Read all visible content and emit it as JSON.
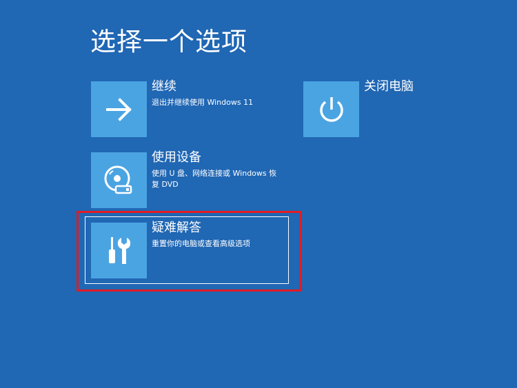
{
  "page_title": "选择一个选项",
  "options": {
    "continue": {
      "title": "继续",
      "description": "退出并继续使用 Windows 11",
      "icon": "arrow-right-icon"
    },
    "shutdown": {
      "title": "关闭电脑",
      "icon": "power-icon"
    },
    "use_device": {
      "title": "使用设备",
      "description": "使用 U 盘、网络连接或 Windows 恢复 DVD",
      "icon": "disc-drive-icon"
    },
    "troubleshoot": {
      "title": "疑难解答",
      "description": "重置你的电脑或查看高级选项",
      "icon": "tools-icon",
      "focused": true,
      "highlighted": true
    }
  },
  "colors": {
    "background": "#2067b4",
    "tile": "#4ba4e2",
    "highlight": "#e31b23",
    "text": "#ffffff"
  }
}
